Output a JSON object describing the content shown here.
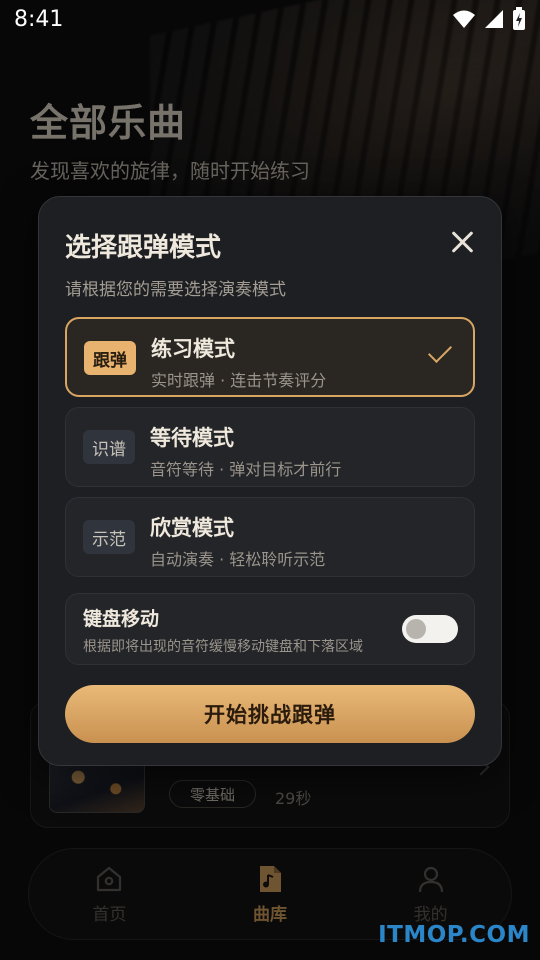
{
  "status_bar": {
    "time": "8:41"
  },
  "page": {
    "title": "全部乐曲",
    "subtitle": "发现喜欢的旋律，随时开始练习"
  },
  "song_card": {
    "level": "零基础",
    "duration": "29秒"
  },
  "bottom_nav": {
    "items": [
      {
        "label": "首页",
        "icon": "home-icon",
        "active": false
      },
      {
        "label": "曲库",
        "icon": "music-library-icon",
        "active": true
      },
      {
        "label": "我的",
        "icon": "profile-icon",
        "active": false
      }
    ]
  },
  "modal": {
    "title": "选择跟弹模式",
    "description": "请根据您的需要选择演奏模式",
    "modes": [
      {
        "badge": "跟弹",
        "name": "练习模式",
        "sub": "实时跟弹 · 连击节奏评分",
        "selected": true
      },
      {
        "badge": "识谱",
        "name": "等待模式",
        "sub": "音符等待 · 弹对目标才前行",
        "selected": false
      },
      {
        "badge": "示范",
        "name": "欣赏模式",
        "sub": "自动演奏 · 轻松聆听示范",
        "selected": false
      }
    ],
    "keyboard_move": {
      "title": "键盘移动",
      "description": "根据即将出现的音符缓慢移动键盘和下落区域",
      "enabled": false
    },
    "start_button": "开始挑战跟弹"
  },
  "watermark": "ITMOP.COM",
  "colors": {
    "accent": "#d8a563",
    "button": "#e9b978",
    "background": "#0e0e10",
    "modal": "#1d1f23"
  }
}
